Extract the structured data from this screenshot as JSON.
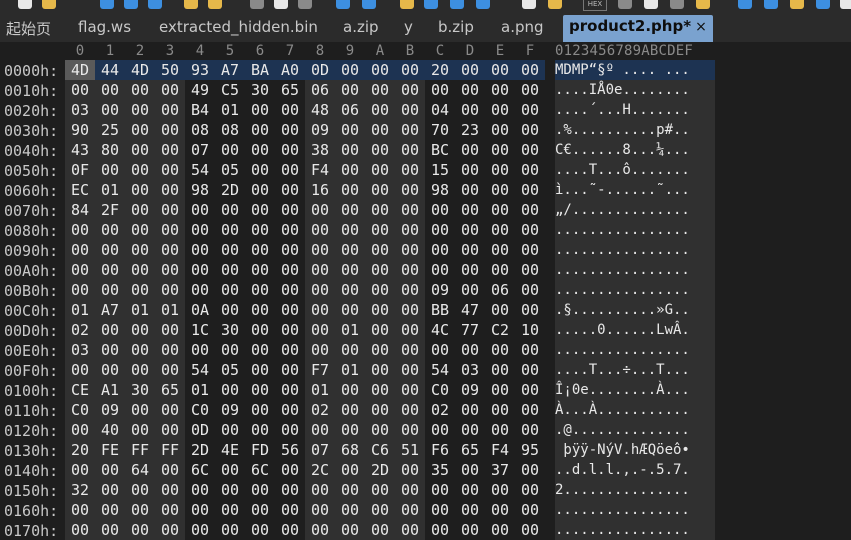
{
  "toolbar": {
    "hex_label": "HEX"
  },
  "tabs": [
    {
      "label": "起始页",
      "active": false
    },
    {
      "label": "flag.ws",
      "active": false
    },
    {
      "label": "extracted_hidden.bin",
      "active": false
    },
    {
      "label": "a.zip",
      "active": false
    },
    {
      "label": "y",
      "active": false
    },
    {
      "label": "b.zip",
      "active": false
    },
    {
      "label": "a.png",
      "active": false
    },
    {
      "label": "product2.php*",
      "active": true,
      "close": "×"
    }
  ],
  "column_headers": [
    "0",
    "1",
    "2",
    "3",
    "4",
    "5",
    "6",
    "7",
    "8",
    "9",
    "A",
    "B",
    "C",
    "D",
    "E",
    "F"
  ],
  "ascii_header": "0123456789ABCDEF",
  "colors": {
    "background": "#1e1e1e",
    "active_tab": "#7aa2cf",
    "current_row": "#1d3352",
    "selected_byte": "#5a5a5a"
  },
  "rows": [
    {
      "offset": "0000h:",
      "bytes": [
        "4D",
        "44",
        "4D",
        "50",
        "93",
        "A7",
        "BA",
        "A0",
        "0D",
        "00",
        "00",
        "00",
        "20",
        "00",
        "00",
        "00"
      ],
      "ascii": "MDMP“§º .... ..."
    },
    {
      "offset": "0010h:",
      "bytes": [
        "00",
        "00",
        "00",
        "00",
        "49",
        "C5",
        "30",
        "65",
        "06",
        "00",
        "00",
        "00",
        "00",
        "00",
        "00",
        "00"
      ],
      "ascii": "....IÅ0e........"
    },
    {
      "offset": "0020h:",
      "bytes": [
        "03",
        "00",
        "00",
        "00",
        "B4",
        "01",
        "00",
        "00",
        "48",
        "06",
        "00",
        "00",
        "04",
        "00",
        "00",
        "00"
      ],
      "ascii": "....´...H......."
    },
    {
      "offset": "0030h:",
      "bytes": [
        "90",
        "25",
        "00",
        "00",
        "08",
        "08",
        "00",
        "00",
        "09",
        "00",
        "00",
        "00",
        "70",
        "23",
        "00",
        "00"
      ],
      "ascii": ".%..........p#.."
    },
    {
      "offset": "0040h:",
      "bytes": [
        "43",
        "80",
        "00",
        "00",
        "07",
        "00",
        "00",
        "00",
        "38",
        "00",
        "00",
        "00",
        "BC",
        "00",
        "00",
        "00"
      ],
      "ascii": "C€......8...¼..."
    },
    {
      "offset": "0050h:",
      "bytes": [
        "0F",
        "00",
        "00",
        "00",
        "54",
        "05",
        "00",
        "00",
        "F4",
        "00",
        "00",
        "00",
        "15",
        "00",
        "00",
        "00"
      ],
      "ascii": "....T...ô......."
    },
    {
      "offset": "0060h:",
      "bytes": [
        "EC",
        "01",
        "00",
        "00",
        "98",
        "2D",
        "00",
        "00",
        "16",
        "00",
        "00",
        "00",
        "98",
        "00",
        "00",
        "00"
      ],
      "ascii": "ì...˜-......˜..."
    },
    {
      "offset": "0070h:",
      "bytes": [
        "84",
        "2F",
        "00",
        "00",
        "00",
        "00",
        "00",
        "00",
        "00",
        "00",
        "00",
        "00",
        "00",
        "00",
        "00",
        "00"
      ],
      "ascii": "„/.............."
    },
    {
      "offset": "0080h:",
      "bytes": [
        "00",
        "00",
        "00",
        "00",
        "00",
        "00",
        "00",
        "00",
        "00",
        "00",
        "00",
        "00",
        "00",
        "00",
        "00",
        "00"
      ],
      "ascii": "................"
    },
    {
      "offset": "0090h:",
      "bytes": [
        "00",
        "00",
        "00",
        "00",
        "00",
        "00",
        "00",
        "00",
        "00",
        "00",
        "00",
        "00",
        "00",
        "00",
        "00",
        "00"
      ],
      "ascii": "................"
    },
    {
      "offset": "00A0h:",
      "bytes": [
        "00",
        "00",
        "00",
        "00",
        "00",
        "00",
        "00",
        "00",
        "00",
        "00",
        "00",
        "00",
        "00",
        "00",
        "00",
        "00"
      ],
      "ascii": "................"
    },
    {
      "offset": "00B0h:",
      "bytes": [
        "00",
        "00",
        "00",
        "00",
        "00",
        "00",
        "00",
        "00",
        "00",
        "00",
        "00",
        "00",
        "09",
        "00",
        "06",
        "00"
      ],
      "ascii": "................"
    },
    {
      "offset": "00C0h:",
      "bytes": [
        "01",
        "A7",
        "01",
        "01",
        "0A",
        "00",
        "00",
        "00",
        "00",
        "00",
        "00",
        "00",
        "BB",
        "47",
        "00",
        "00"
      ],
      "ascii": ".§..........»G.."
    },
    {
      "offset": "00D0h:",
      "bytes": [
        "02",
        "00",
        "00",
        "00",
        "1C",
        "30",
        "00",
        "00",
        "00",
        "01",
        "00",
        "00",
        "4C",
        "77",
        "C2",
        "10"
      ],
      "ascii": ".....0......LwÂ."
    },
    {
      "offset": "00E0h:",
      "bytes": [
        "03",
        "00",
        "00",
        "00",
        "00",
        "00",
        "00",
        "00",
        "00",
        "00",
        "00",
        "00",
        "00",
        "00",
        "00",
        "00"
      ],
      "ascii": "................"
    },
    {
      "offset": "00F0h:",
      "bytes": [
        "00",
        "00",
        "00",
        "00",
        "54",
        "05",
        "00",
        "00",
        "F7",
        "01",
        "00",
        "00",
        "54",
        "03",
        "00",
        "00"
      ],
      "ascii": "....T...÷...T..."
    },
    {
      "offset": "0100h:",
      "bytes": [
        "CE",
        "A1",
        "30",
        "65",
        "01",
        "00",
        "00",
        "00",
        "01",
        "00",
        "00",
        "00",
        "C0",
        "09",
        "00",
        "00"
      ],
      "ascii": "Î¡0e........À..."
    },
    {
      "offset": "0110h:",
      "bytes": [
        "C0",
        "09",
        "00",
        "00",
        "C0",
        "09",
        "00",
        "00",
        "02",
        "00",
        "00",
        "00",
        "02",
        "00",
        "00",
        "00"
      ],
      "ascii": "À...À..........."
    },
    {
      "offset": "0120h:",
      "bytes": [
        "00",
        "40",
        "00",
        "00",
        "0D",
        "00",
        "00",
        "00",
        "00",
        "00",
        "00",
        "00",
        "00",
        "00",
        "00",
        "00"
      ],
      "ascii": ".@.............."
    },
    {
      "offset": "0130h:",
      "bytes": [
        "20",
        "FE",
        "FF",
        "FF",
        "2D",
        "4E",
        "FD",
        "56",
        "07",
        "68",
        "C6",
        "51",
        "F6",
        "65",
        "F4",
        "95"
      ],
      "ascii": " þÿÿ-NýV.hÆQöeô•"
    },
    {
      "offset": "0140h:",
      "bytes": [
        "00",
        "00",
        "64",
        "00",
        "6C",
        "00",
        "6C",
        "00",
        "2C",
        "00",
        "2D",
        "00",
        "35",
        "00",
        "37",
        "00"
      ],
      "ascii": "..d.l.l.,.-.5.7."
    },
    {
      "offset": "0150h:",
      "bytes": [
        "32",
        "00",
        "00",
        "00",
        "00",
        "00",
        "00",
        "00",
        "00",
        "00",
        "00",
        "00",
        "00",
        "00",
        "00",
        "00"
      ],
      "ascii": "2..............."
    },
    {
      "offset": "0160h:",
      "bytes": [
        "00",
        "00",
        "00",
        "00",
        "00",
        "00",
        "00",
        "00",
        "00",
        "00",
        "00",
        "00",
        "00",
        "00",
        "00",
        "00"
      ],
      "ascii": "................"
    },
    {
      "offset": "0170h:",
      "bytes": [
        "00",
        "00",
        "00",
        "00",
        "00",
        "00",
        "00",
        "00",
        "00",
        "00",
        "00",
        "00",
        "00",
        "00",
        "00",
        "00"
      ],
      "ascii": "................"
    }
  ]
}
